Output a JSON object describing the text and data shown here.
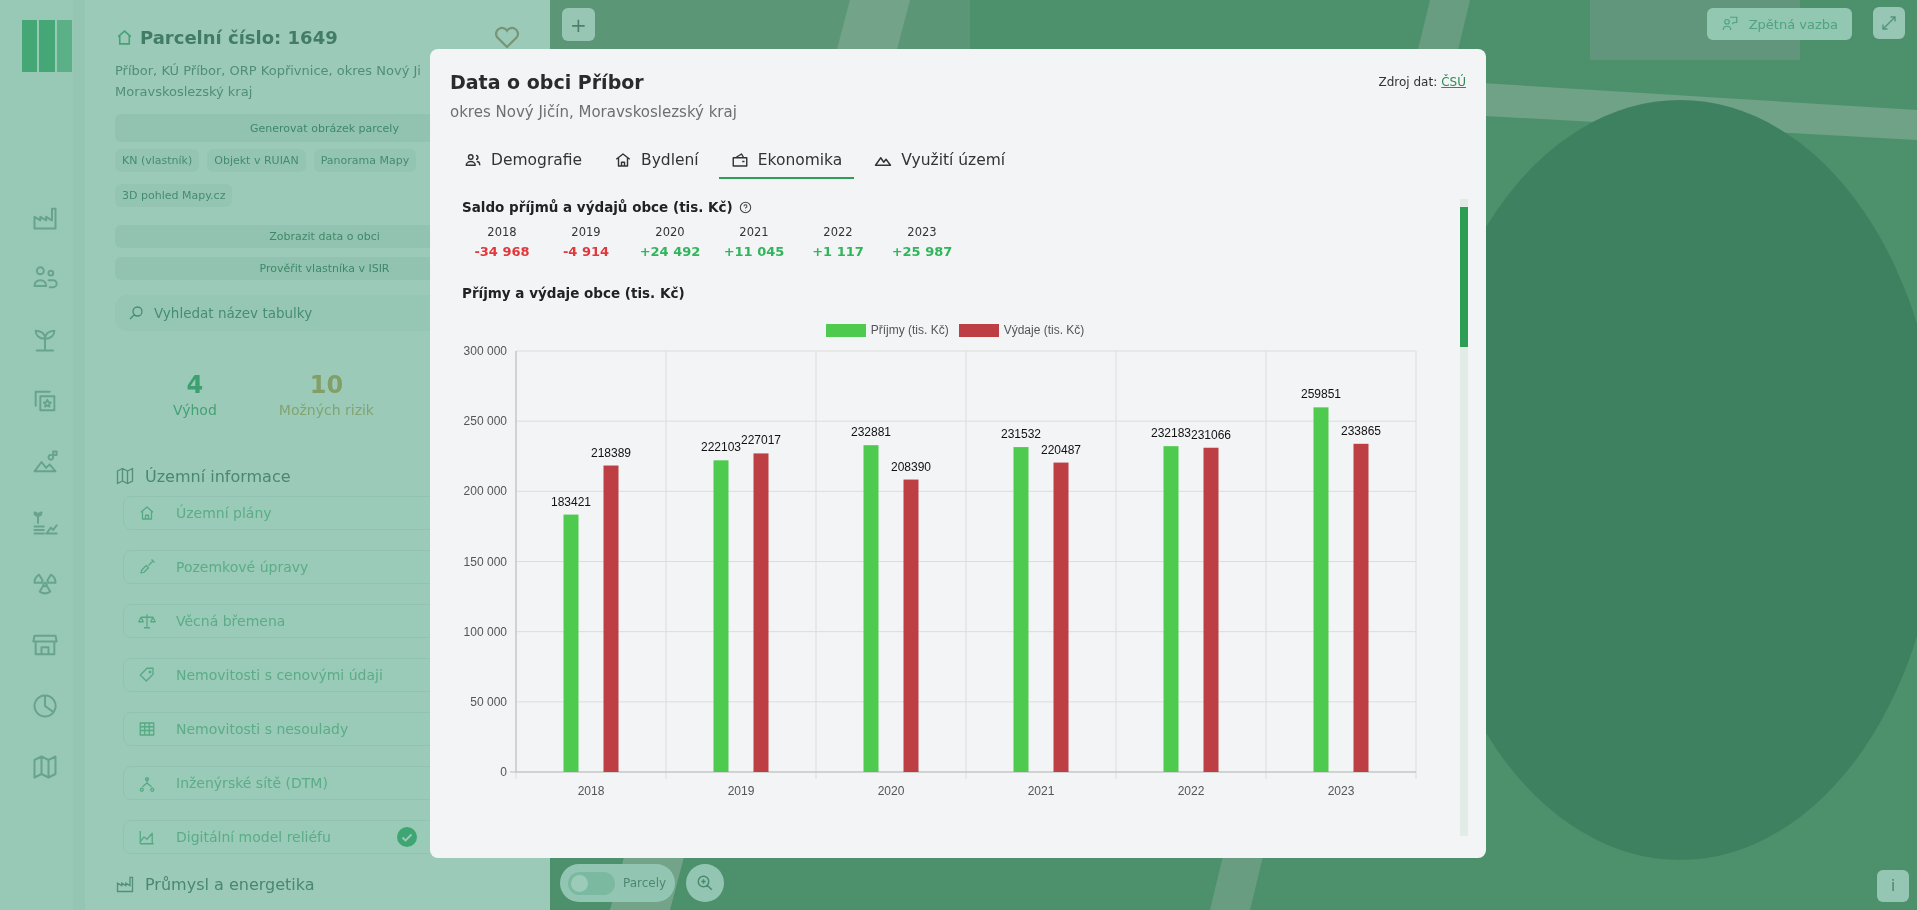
{
  "sidebar": {
    "title": "Parcelní číslo: 1649",
    "location_lines": [
      "Příbor, KÚ Příbor, ORP Kopřivnice, okres Nový Ji",
      "Moravskoslezský kraj"
    ],
    "generate_button": "Generovat obrázek parcely",
    "links": [
      "KN (vlastník)",
      "Objekt v RUIAN",
      "Panorama Mapy",
      "3D pohled Mapy.cz"
    ],
    "actions": [
      "Zobrazit data o obci",
      "Prověřit vlastníka v ISIR"
    ],
    "search": {
      "placeholder": "Vyhledat název tabulky"
    },
    "stats": [
      {
        "value": "4",
        "label": "Výhod",
        "kind": "benefit"
      },
      {
        "value": "10",
        "label": "Možných rizik",
        "kind": "risk"
      }
    ],
    "sections": [
      {
        "title": "Územní informace",
        "items": [
          {
            "label": "Územní plány",
            "checked": false
          },
          {
            "label": "Pozemkové úpravy",
            "checked": false
          },
          {
            "label": "Věcná břemena",
            "checked": false
          },
          {
            "label": "Nemovitosti s cenovými údaji",
            "checked": false
          },
          {
            "label": "Nemovitosti s nesoulady",
            "checked": false
          },
          {
            "label": "Inženýrské sítě (DTM)",
            "checked": false
          },
          {
            "label": "Digitální model reliéfu",
            "checked": true
          }
        ]
      },
      {
        "title": "Průmysl a energetika"
      }
    ]
  },
  "map": {
    "feedback_button": "Zpětná vazba",
    "layer_toggle": {
      "label": "Parcely",
      "on": false
    },
    "info_button": "i",
    "zoom_in_button": "+"
  },
  "modal": {
    "title": "Data o obci Příbor",
    "subtitle": "okres Nový Jičín, Moravskoslezský kraj",
    "source_label": "Zdroj dat:",
    "source_link": "ČSÚ",
    "tabs": [
      {
        "label": "Demografie",
        "selected": false
      },
      {
        "label": "Bydlení",
        "selected": false
      },
      {
        "label": "Ekonomika",
        "selected": true
      },
      {
        "label": "Využití území",
        "selected": false
      }
    ],
    "balance": {
      "title": "Saldo příjmů a výdajů obce (tis. Kč)",
      "years": [
        {
          "year": "2018",
          "value": "-34 968",
          "kind": "negative"
        },
        {
          "year": "2019",
          "value": "-4 914",
          "kind": "negative"
        },
        {
          "year": "2020",
          "value": "+24 492",
          "kind": "positive"
        },
        {
          "year": "2021",
          "value": "+11 045",
          "kind": "positive"
        },
        {
          "year": "2022",
          "value": "+1 117",
          "kind": "positive"
        },
        {
          "year": "2023",
          "value": "+25 987",
          "kind": "positive"
        }
      ]
    },
    "chart_data": {
      "type": "bar",
      "title": "Příjmy a výdaje obce (tis. Kč)",
      "categories": [
        "2018",
        "2019",
        "2020",
        "2021",
        "2022",
        "2023"
      ],
      "series": [
        {
          "name": "Příjmy (tis. Kč)",
          "color": "#4ecb4e",
          "values": [
            183421,
            222103,
            232881,
            231532,
            232183,
            259851
          ]
        },
        {
          "name": "Výdaje (tis. Kč)",
          "color": "#be3f43",
          "values": [
            218389,
            227017,
            208390,
            220487,
            231066,
            233865
          ]
        }
      ],
      "ylim": [
        0,
        300000
      ],
      "yticks": [
        {
          "value": 0,
          "label": "0"
        },
        {
          "value": 50000,
          "label": "50 000"
        },
        {
          "value": 100000,
          "label": "100 000"
        },
        {
          "value": 150000,
          "label": "150 000"
        },
        {
          "value": 200000,
          "label": "200 000"
        },
        {
          "value": 250000,
          "label": "250 000"
        },
        {
          "value": 300000,
          "label": "300 000"
        }
      ],
      "grid": true,
      "legend": "top",
      "data_labels": true
    }
  }
}
